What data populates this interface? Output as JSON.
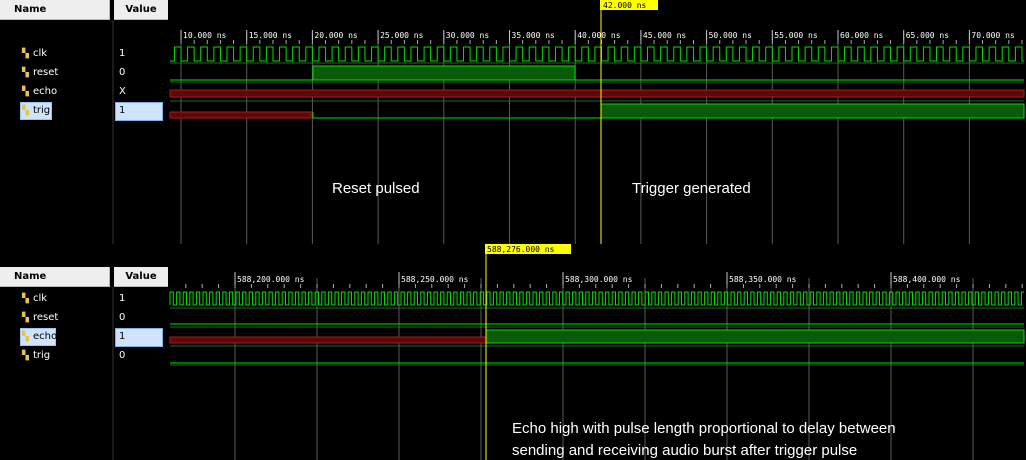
{
  "pane1": {
    "name_header": "Name",
    "value_header": "Value",
    "signals": [
      {
        "name": "clk",
        "value": "1"
      },
      {
        "name": "reset",
        "value": "0"
      },
      {
        "name": "echo",
        "value": "X"
      },
      {
        "name": "trig",
        "value": "1"
      }
    ],
    "cursor_label": "42.000 ns",
    "ticks": [
      "10.000 ns",
      "15.000 ns",
      "20.000 ns",
      "25.000 ns",
      "30.000 ns",
      "35.000 ns",
      "40.000 ns",
      "45.000 ns",
      "50.000 ns",
      "55.000 ns",
      "60.000 ns",
      "65.000 ns",
      "70.000 ns"
    ],
    "annotation_reset": "Reset pulsed",
    "annotation_trigger": "Trigger generated"
  },
  "pane2": {
    "name_header": "Name",
    "value_header": "Value",
    "signals": [
      {
        "name": "clk",
        "value": "1"
      },
      {
        "name": "reset",
        "value": "0"
      },
      {
        "name": "echo",
        "value": "1"
      },
      {
        "name": "trig",
        "value": "0"
      }
    ],
    "cursor_label": "588,276.000 ns",
    "ticks": [
      "588,200.000 ns",
      "588,250.000 ns",
      "588,300.000 ns",
      "588,350.000 ns",
      "588,400.000 ns"
    ],
    "annotation_echo_line1": "Echo high with pulse length proportional to delay between",
    "annotation_echo_line2": "sending and receiving audio burst after trigger pulse"
  },
  "colors": {
    "wave_green": "#00e000",
    "wave_fill": "#0a5a0a",
    "undefined_red": "#b01818",
    "cursor": "#ffff00",
    "grid": "#5a5a5a"
  }
}
